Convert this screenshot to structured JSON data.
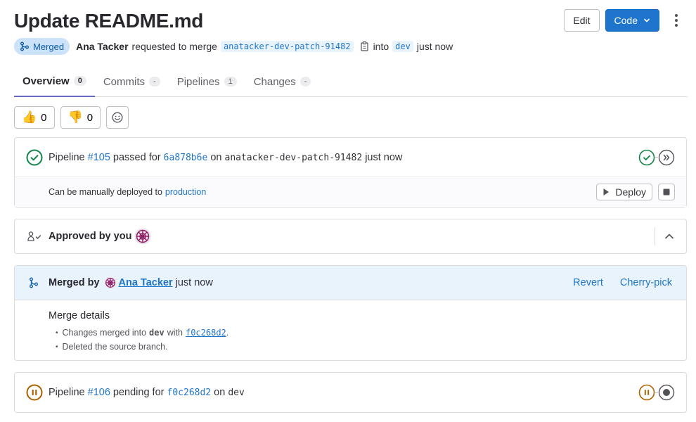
{
  "page": {
    "title": "Update README.md"
  },
  "top_actions": {
    "edit_label": "Edit",
    "code_label": "Code"
  },
  "meta": {
    "status_badge": "Merged",
    "author": "Ana Tacker",
    "requested_text": "requested to merge",
    "source_branch": "anatacker-dev-patch-91482",
    "into_text": "into",
    "target_branch": "dev",
    "time": "just now"
  },
  "tabs": [
    {
      "label": "Overview",
      "count": "0"
    },
    {
      "label": "Commits",
      "count": "-"
    },
    {
      "label": "Pipelines",
      "count": "1"
    },
    {
      "label": "Changes",
      "count": "-"
    }
  ],
  "awards": {
    "thumbs_up": "0",
    "thumbs_down": "0"
  },
  "pipeline1": {
    "prefix": "Pipeline",
    "id": "#105",
    "status_text": "passed for",
    "commit": "6a878b6e",
    "on_text": "on",
    "branch": "anatacker-dev-patch-91482",
    "time": "just now",
    "deploy_text": "Can be manually deployed to",
    "environment": "production",
    "deploy_label": "Deploy"
  },
  "approval": {
    "label": "Approved by you"
  },
  "merged": {
    "prefix": "Merged by",
    "user": "Ana Tacker",
    "time": "just now",
    "revert_label": "Revert",
    "cherry_pick_label": "Cherry-pick",
    "details_title": "Merge details",
    "detail1_prefix": "Changes merged into",
    "detail1_branch": "dev",
    "detail1_with": "with",
    "detail1_commit": "f0c268d2",
    "detail1_suffix": ".",
    "detail2": "Deleted the source branch."
  },
  "pipeline2": {
    "prefix": "Pipeline",
    "id": "#106",
    "status_text": "pending for",
    "commit": "f0c268d2",
    "on_text": "on",
    "branch": "dev"
  },
  "colors": {
    "accent": "#1f75cb",
    "success": "#108548",
    "pending": "#ab6100",
    "merged_bg": "#e9f3fc"
  }
}
